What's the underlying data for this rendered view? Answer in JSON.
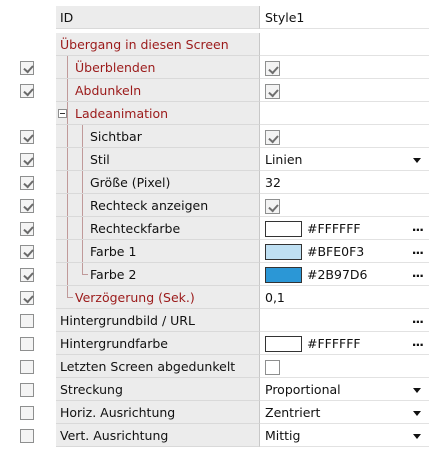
{
  "header": {
    "name": "ID",
    "value": "Style1"
  },
  "rows": [
    {
      "label": "Übergang in diesen Screen",
      "group": true
    },
    {
      "label": "Überblenden",
      "group": true,
      "value_checkbox": "checked"
    },
    {
      "label": "Abdunkeln",
      "group": true,
      "value_checkbox": "checked"
    },
    {
      "label": "Ladeanimation",
      "group": true
    },
    {
      "label": "Sichtbar",
      "value_checkbox": "checked"
    },
    {
      "label": "Stil",
      "value": "Linien",
      "dropdown": true
    },
    {
      "label": "Größe (Pixel)",
      "value": "32"
    },
    {
      "label": "Rechteck anzeigen",
      "value_checkbox": "checked"
    },
    {
      "label": "Rechteckfarbe",
      "color": "#FFFFFF",
      "hex": "#FFFFFF",
      "ellipsis": "..."
    },
    {
      "label": "Farbe 1",
      "color": "#BFE0F3",
      "hex": "#BFE0F3",
      "ellipsis": "..."
    },
    {
      "label": "Farbe 2",
      "color": "#2B97D6",
      "hex": "#2B97D6",
      "ellipsis": "..."
    },
    {
      "label": "Verzögerung (Sek.)",
      "group": true,
      "value": "0,1"
    },
    {
      "label": "Hintergrundbild / URL",
      "ellipsis": "..."
    },
    {
      "label": "Hintergrundfarbe",
      "color": "#FFFFFF",
      "hex": "#FFFFFF",
      "ellipsis": "..."
    },
    {
      "label": "Letzten Screen abgedunkelt",
      "value_checkbox": "unchecked"
    },
    {
      "label": "Streckung",
      "value": "Proportional",
      "dropdown": true
    },
    {
      "label": "Horiz. Ausrichtung",
      "value": "Zentriert",
      "dropdown": true
    },
    {
      "label": "Vert. Ausrichtung",
      "value": "Mittig",
      "dropdown": true
    }
  ],
  "row_checkboxes": [
    "none",
    "checked",
    "checked",
    "none",
    "checked",
    "checked",
    "checked",
    "checked",
    "checked",
    "checked",
    "checked",
    "checked",
    "unchecked",
    "unchecked",
    "unchecked",
    "unchecked",
    "unchecked",
    "unchecked"
  ],
  "colors": {
    "group_label": "#9b1a1a",
    "name_column_bg": "#ececec"
  }
}
